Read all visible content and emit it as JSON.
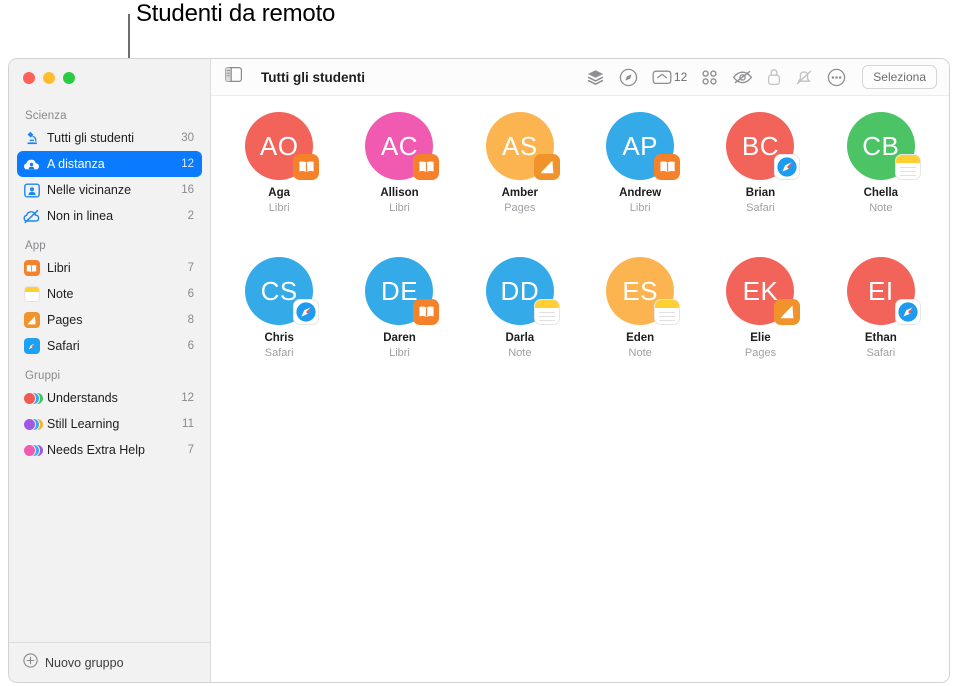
{
  "callout": {
    "label": "Studenti da remoto"
  },
  "window": {
    "traffic_lights": [
      "close",
      "minimize",
      "zoom"
    ]
  },
  "sidebar": {
    "sections": [
      {
        "title": "Scienza",
        "items": [
          {
            "label": "Tutti gli studenti",
            "count": "30",
            "icon": "microscope-icon",
            "selected": false
          },
          {
            "label": "A distanza",
            "count": "12",
            "icon": "cloud-person-icon",
            "selected": true
          },
          {
            "label": "Nelle vicinanze",
            "count": "16",
            "icon": "person-frame-icon",
            "selected": false
          },
          {
            "label": "Non in linea",
            "count": "2",
            "icon": "cloud-slash-icon",
            "selected": false
          }
        ]
      },
      {
        "title": "App",
        "items": [
          {
            "label": "Libri",
            "count": "7",
            "icon": "books-app-icon",
            "selected": false
          },
          {
            "label": "Note",
            "count": "6",
            "icon": "notes-app-icon",
            "selected": false
          },
          {
            "label": "Pages",
            "count": "8",
            "icon": "pages-app-icon",
            "selected": false
          },
          {
            "label": "Safari",
            "count": "6",
            "icon": "safari-app-icon",
            "selected": false
          }
        ]
      },
      {
        "title": "Gruppi",
        "items": [
          {
            "label": "Understands",
            "count": "12",
            "icon": "group-avatars-icon",
            "selected": false,
            "avatars": [
              "#f05a52",
              "#3aa8f0",
              "#3ec75a"
            ]
          },
          {
            "label": "Still Learning",
            "count": "11",
            "icon": "group-avatars-icon",
            "selected": false,
            "avatars": [
              "#a05ae0",
              "#3aa8f0",
              "#f5b42b"
            ]
          },
          {
            "label": "Needs Extra Help",
            "count": "7",
            "icon": "group-avatars-icon",
            "selected": false,
            "avatars": [
              "#f05ab0",
              "#3aa8f0",
              "#a05ae0"
            ]
          }
        ]
      }
    ],
    "new_group": {
      "label": "Nuovo gruppo",
      "icon": "plus-circle-icon"
    }
  },
  "toolbar": {
    "sidebar_toggle_icon": "sidebar-toggle-icon",
    "title": "Tutti gli studenti",
    "actions": [
      {
        "name": "layers-icon",
        "label": ""
      },
      {
        "name": "compass-navigate-icon",
        "label": ""
      },
      {
        "name": "inbox-icon",
        "label": "12"
      },
      {
        "name": "grid-apps-icon",
        "label": ""
      },
      {
        "name": "eye-slash-icon",
        "label": ""
      },
      {
        "name": "lock-icon",
        "label": ""
      },
      {
        "name": "bell-slash-icon",
        "label": ""
      },
      {
        "name": "more-ellipsis-icon",
        "label": ""
      }
    ],
    "select_label": "Seleziona"
  },
  "colors": {
    "accent": "#0a7bff",
    "sidebar_bg": "#f2f2f2",
    "secondary_text": "#8a8a8e"
  },
  "students": [
    {
      "initials": "AO",
      "name": "Aga",
      "app": "Libri",
      "color": "#f2645a",
      "badge": "books"
    },
    {
      "initials": "AC",
      "name": "Allison",
      "app": "Libri",
      "color": "#f05ab0",
      "badge": "books"
    },
    {
      "initials": "AS",
      "name": "Amber",
      "app": "Pages",
      "color": "#fbb450",
      "badge": "pages"
    },
    {
      "initials": "AP",
      "name": "Andrew",
      "app": "Libri",
      "color": "#34aae8",
      "badge": "books"
    },
    {
      "initials": "BC",
      "name": "Brian",
      "app": "Safari",
      "color": "#f2645a",
      "badge": "safari"
    },
    {
      "initials": "CB",
      "name": "Chella",
      "app": "Note",
      "color": "#4cc466",
      "badge": "notes"
    },
    {
      "initials": "CS",
      "name": "Chris",
      "app": "Safari",
      "color": "#34aae8",
      "badge": "safari"
    },
    {
      "initials": "DE",
      "name": "Daren",
      "app": "Libri",
      "color": "#34aae8",
      "badge": "books"
    },
    {
      "initials": "DD",
      "name": "Darla",
      "app": "Note",
      "color": "#34aae8",
      "badge": "notes"
    },
    {
      "initials": "ES",
      "name": "Eden",
      "app": "Note",
      "color": "#fbb450",
      "badge": "notes"
    },
    {
      "initials": "EK",
      "name": "Elie",
      "app": "Pages",
      "color": "#f2645a",
      "badge": "pages"
    },
    {
      "initials": "EI",
      "name": "Ethan",
      "app": "Safari",
      "color": "#f2645a",
      "badge": "safari"
    }
  ]
}
